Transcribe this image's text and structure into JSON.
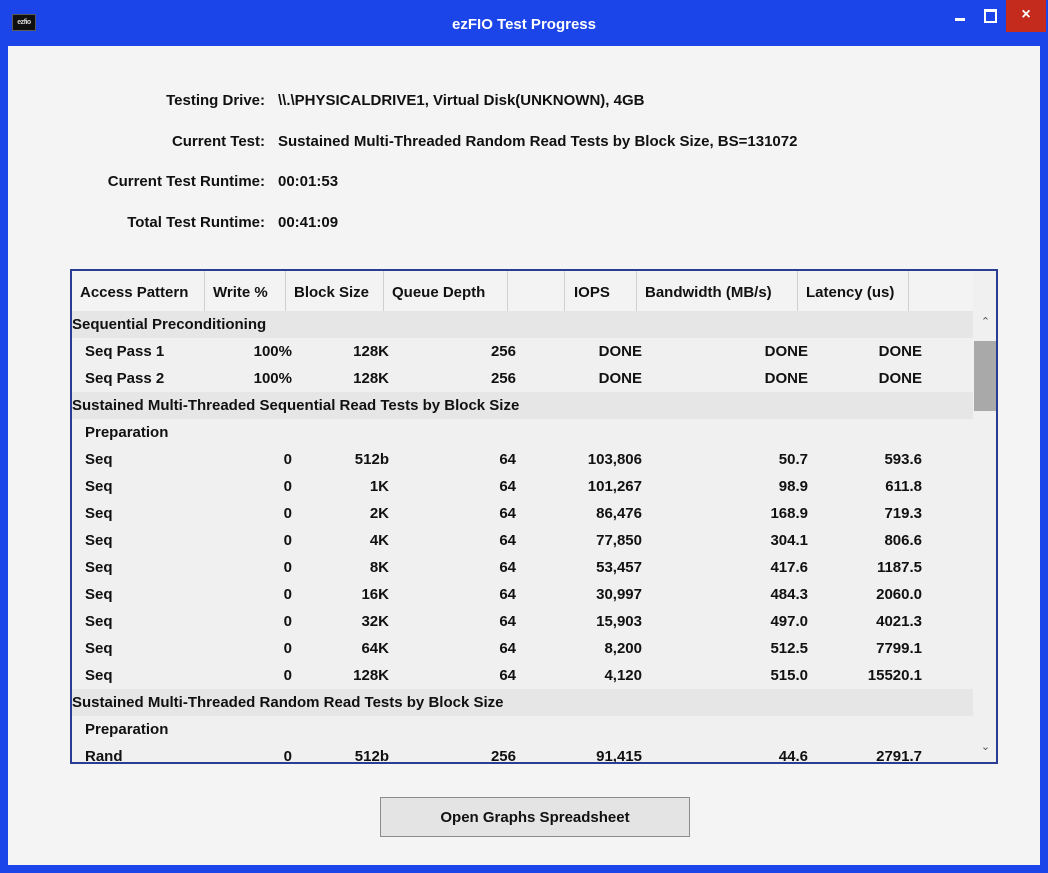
{
  "window": {
    "title": "ezFIO Test Progress",
    "app_icon_text": "ezfio",
    "close_glyph": "×"
  },
  "info": {
    "testing_drive_label": "Testing Drive:",
    "testing_drive_value": "\\\\.\\PHYSICALDRIVE1, Virtual Disk(UNKNOWN), 4GB",
    "current_test_label": "Current Test:",
    "current_test_value": "Sustained Multi-Threaded Random Read Tests by Block Size, BS=131072",
    "current_runtime_label": "Current Test Runtime:",
    "current_runtime_value": "00:01:53",
    "total_runtime_label": "Total Test Runtime:",
    "total_runtime_value": "00:41:09"
  },
  "table": {
    "columns": [
      "Access Pattern",
      "Write %",
      "Block Size",
      "Queue Depth",
      "",
      "IOPS",
      "Bandwidth (MB/s)",
      "Latency (us)"
    ],
    "rows": [
      {
        "type": "group",
        "label": "Sequential Preconditioning"
      },
      {
        "type": "data",
        "cells": [
          "Seq Pass 1",
          "100%",
          "128K",
          "256",
          "DONE",
          "DONE",
          "DONE"
        ]
      },
      {
        "type": "data",
        "cells": [
          "Seq Pass 2",
          "100%",
          "128K",
          "256",
          "DONE",
          "DONE",
          "DONE"
        ]
      },
      {
        "type": "group",
        "label": "Sustained Multi-Threaded Sequential Read Tests by Block Size"
      },
      {
        "type": "sub",
        "label": "Preparation"
      },
      {
        "type": "data",
        "cells": [
          "Seq",
          "0",
          "512b",
          "64",
          "103,806",
          "50.7",
          "593.6"
        ]
      },
      {
        "type": "data",
        "cells": [
          "Seq",
          "0",
          "1K",
          "64",
          "101,267",
          "98.9",
          "611.8"
        ]
      },
      {
        "type": "data",
        "cells": [
          "Seq",
          "0",
          "2K",
          "64",
          "86,476",
          "168.9",
          "719.3"
        ]
      },
      {
        "type": "data",
        "cells": [
          "Seq",
          "0",
          "4K",
          "64",
          "77,850",
          "304.1",
          "806.6"
        ]
      },
      {
        "type": "data",
        "cells": [
          "Seq",
          "0",
          "8K",
          "64",
          "53,457",
          "417.6",
          "1187.5"
        ]
      },
      {
        "type": "data",
        "cells": [
          "Seq",
          "0",
          "16K",
          "64",
          "30,997",
          "484.3",
          "2060.0"
        ]
      },
      {
        "type": "data",
        "cells": [
          "Seq",
          "0",
          "32K",
          "64",
          "15,903",
          "497.0",
          "4021.3"
        ]
      },
      {
        "type": "data",
        "cells": [
          "Seq",
          "0",
          "64K",
          "64",
          "8,200",
          "512.5",
          "7799.1"
        ]
      },
      {
        "type": "data",
        "cells": [
          "Seq",
          "0",
          "128K",
          "64",
          "4,120",
          "515.0",
          "15520.1"
        ]
      },
      {
        "type": "group",
        "label": "Sustained Multi-Threaded Random Read Tests by Block Size"
      },
      {
        "type": "sub",
        "label": "Preparation"
      },
      {
        "type": "data",
        "cells": [
          "Rand",
          "0",
          "512b",
          "256",
          "91,415",
          "44.6",
          "2791.7"
        ]
      }
    ]
  },
  "scrollbar": {
    "up_glyph": "⌃",
    "down_glyph": "⌄"
  },
  "buttons": {
    "open_graphs": "Open Graphs Spreadsheet"
  }
}
